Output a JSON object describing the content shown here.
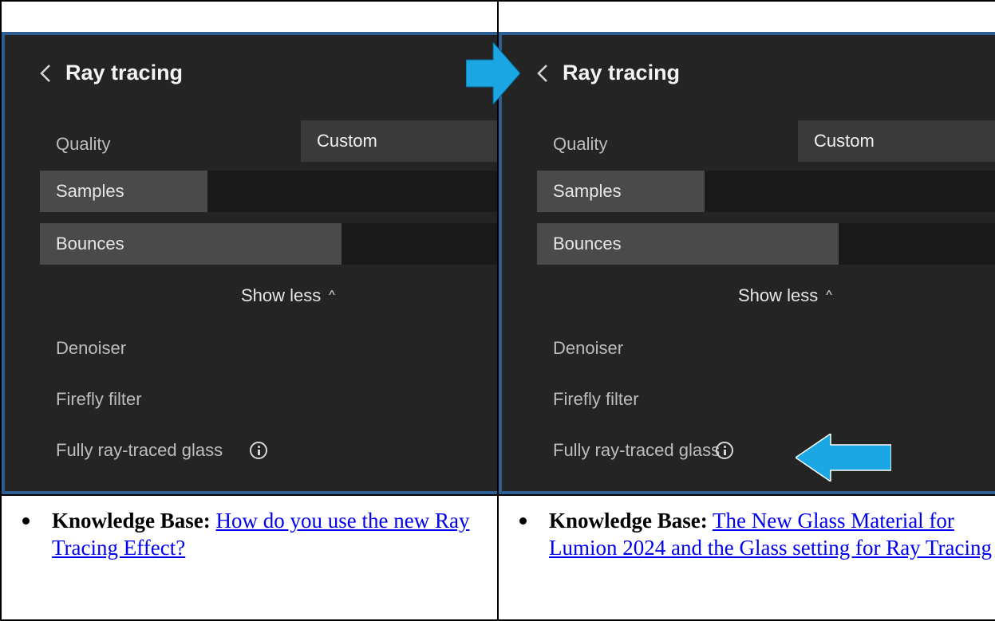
{
  "panels": [
    {
      "title": "Ray tracing",
      "quality_label": "Quality",
      "quality_value": "Custom",
      "samples_label": "Samples",
      "samples_fill": 0.35,
      "bounces_label": "Bounces",
      "bounces_fill": 0.63,
      "show_less_label": "Show less",
      "denoiser_label": "Denoiser",
      "firefly_label": "Firefly filter",
      "glass_label": "Fully ray-traced glass"
    },
    {
      "title": "Ray tracing",
      "quality_label": "Quality",
      "quality_value": "Custom",
      "samples_label": "Samples",
      "samples_fill": 0.35,
      "bounces_label": "Bounces",
      "bounces_fill": 0.63,
      "show_less_label": "Show less",
      "denoiser_label": "Denoiser",
      "firefly_label": "Firefly filter",
      "glass_label": "Fully ray-traced glass"
    }
  ],
  "knowledge_base": [
    {
      "label": "Knowledge Base:",
      "link_text": "How do you use the new Ray Tracing Effect?"
    },
    {
      "label": "Knowledge Base:",
      "link_text": "The New Glass Material for Lumion 2024 and the Glass setting for Ray Tracing"
    }
  ],
  "icons": {
    "back": "chevron-left-icon",
    "caret": "chevron-up-icon",
    "info": "info-icon",
    "callout": "arrow-callout"
  },
  "colors": {
    "panel_bg": "#242424",
    "panel_border": "#2d5e94",
    "callout_arrow": "#1aa7e4",
    "link": "#0000ee"
  }
}
